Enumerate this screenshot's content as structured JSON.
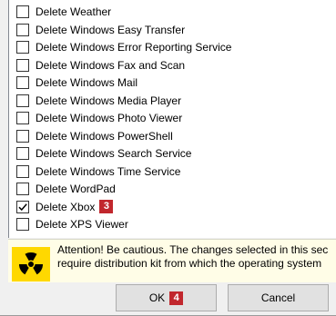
{
  "list": {
    "items": [
      {
        "label": "Delete Weather",
        "checked": false
      },
      {
        "label": "Delete Windows Easy Transfer",
        "checked": false
      },
      {
        "label": "Delete Windows Error Reporting Service",
        "checked": false
      },
      {
        "label": "Delete Windows Fax and Scan",
        "checked": false
      },
      {
        "label": "Delete Windows Mail",
        "checked": false
      },
      {
        "label": "Delete Windows Media Player",
        "checked": false
      },
      {
        "label": "Delete Windows Photo Viewer",
        "checked": false
      },
      {
        "label": "Delete Windows PowerShell",
        "checked": false
      },
      {
        "label": "Delete Windows Search Service",
        "checked": false
      },
      {
        "label": "Delete Windows Time Service",
        "checked": false
      },
      {
        "label": "Delete WordPad",
        "checked": false
      },
      {
        "label": "Delete Xbox",
        "checked": true,
        "badge": "3"
      },
      {
        "label": "Delete XPS Viewer",
        "checked": false
      }
    ]
  },
  "warning": {
    "line1": "Attention! Be cautious. The changes selected in this sec",
    "line2": "require distribution kit from which the operating system",
    "icon": "radiation-icon"
  },
  "buttons": {
    "ok_label": "OK",
    "ok_badge": "4",
    "cancel_label": "Cancel"
  },
  "colors": {
    "badge": "#c1272d",
    "warning_bg": "#fffde7",
    "radiation_yellow": "#ffd800"
  }
}
